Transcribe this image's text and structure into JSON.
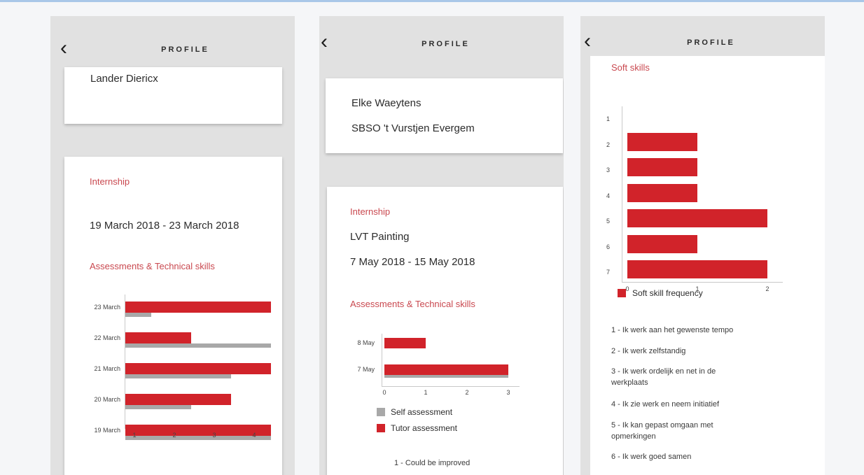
{
  "profile1": {
    "title": "PROFILE",
    "name": "Lander Diericx",
    "internship_heading": "Internship",
    "period": "19 March 2018 - 23 March 2018",
    "assess_heading": "Assessments & Technical skills"
  },
  "profile2": {
    "title": "PROFILE",
    "name": "Elke Waeytens",
    "school": "SBSO 't Vurstjen Evergem",
    "internship_heading": "Internship",
    "company": "LVT Painting",
    "period": "7 May 2018 - 15 May 2018",
    "assess_heading": "Assessments & Technical skills",
    "legend": [
      "Self assessment",
      "Tutor assessment"
    ],
    "note": "1 - Could be improved"
  },
  "profile3": {
    "title": "PROFILE",
    "heading": "Soft skills",
    "legend": "Soft skill frequency",
    "notes": [
      "1 - Ik werk aan het gewenste tempo",
      "2 - Ik werk zelfstandig",
      "3 - Ik werk ordelijk en net in de werkplaats",
      "4 - Ik zie werk en neem initiatief",
      "5 - Ik kan gepast omgaan met opmerkingen",
      "6 - Ik werk goed samen"
    ]
  },
  "colors": {
    "accent": "#d1232a",
    "self": "#a8a8a8",
    "heading": "#c9484f"
  },
  "icons": {
    "back": "chevron-left-icon"
  },
  "chart_data": [
    {
      "type": "bar",
      "orientation": "horizontal",
      "categories": [
        "23 March",
        "22 March",
        "21 March",
        "20 March",
        "19 March"
      ],
      "series": [
        {
          "values": [
            4,
            2,
            4,
            3,
            4
          ]
        },
        {
          "values": [
            1,
            4,
            3,
            2,
            4
          ]
        }
      ],
      "x_ticks": [
        1,
        2,
        3,
        4
      ]
    },
    {
      "type": "bar",
      "orientation": "horizontal",
      "categories": [
        "8 May",
        "7 May"
      ],
      "series": [
        {
          "name": "Self assessment",
          "values": [
            0,
            3
          ]
        },
        {
          "name": "Tutor assessment",
          "values": [
            1,
            3
          ]
        }
      ],
      "x_ticks": [
        0,
        1,
        2,
        3
      ]
    },
    {
      "type": "bar",
      "orientation": "horizontal",
      "categories": [
        "1",
        "2",
        "3",
        "4",
        "5",
        "6",
        "7"
      ],
      "series": [
        {
          "name": "Soft skill frequency",
          "values": [
            0,
            1,
            1,
            1,
            2,
            1,
            2
          ]
        }
      ],
      "x_ticks": [
        0,
        1,
        2
      ]
    }
  ]
}
